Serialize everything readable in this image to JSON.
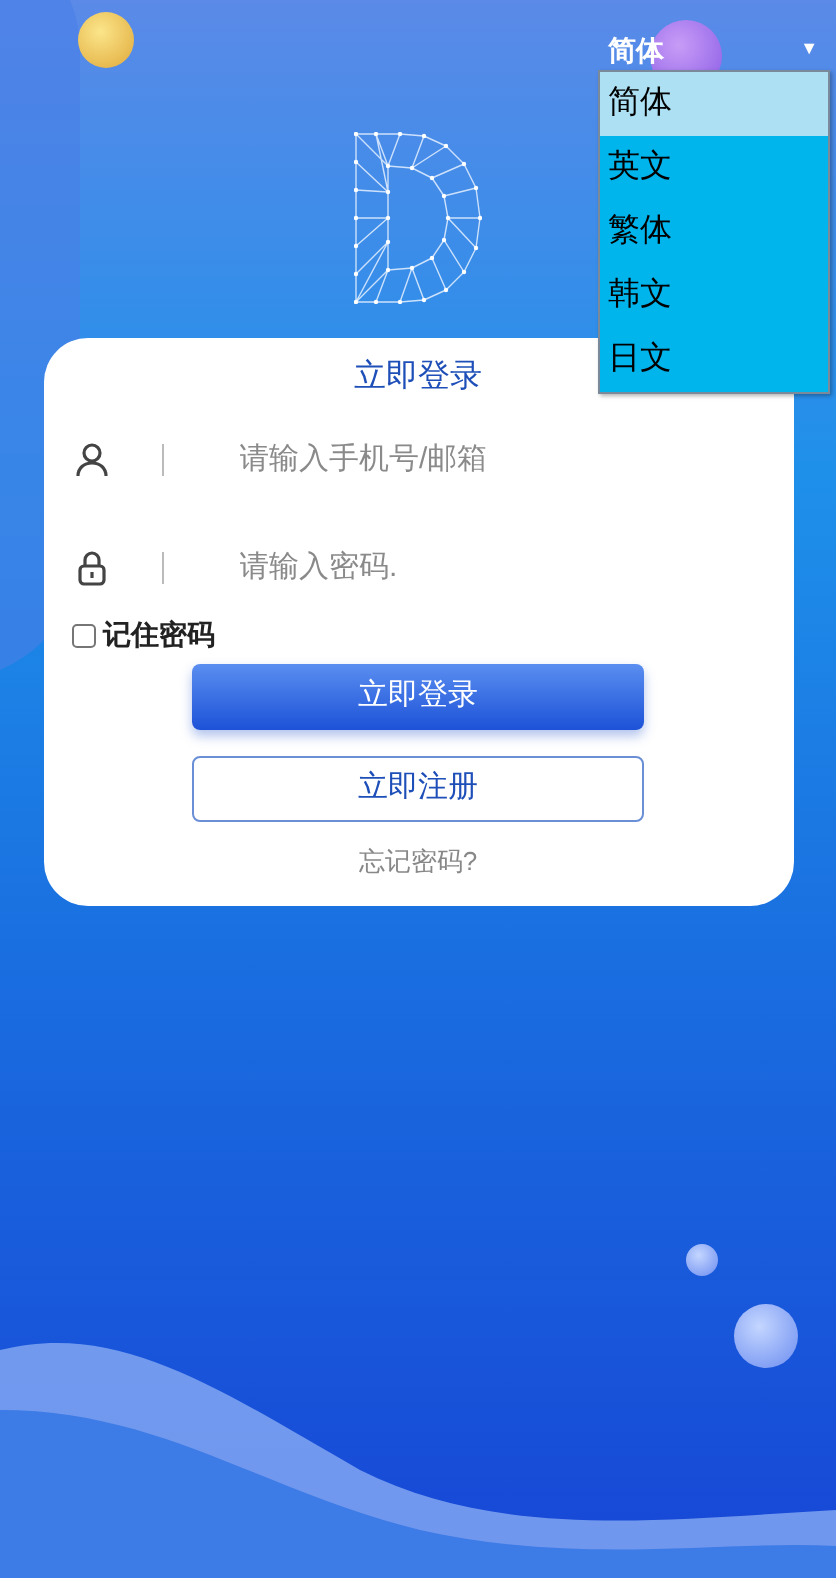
{
  "language_select": {
    "value": "简体",
    "caret": "▼",
    "expanded": true,
    "options": [
      {
        "label": "简体",
        "selected": true
      },
      {
        "label": "英文",
        "selected": false
      },
      {
        "label": "繁体",
        "selected": false
      },
      {
        "label": "韩文",
        "selected": false
      },
      {
        "label": "日文",
        "selected": false
      }
    ]
  },
  "login_card": {
    "title": "立即登录",
    "fields": [
      {
        "kind": "user",
        "placeholder": "请输入手机号/邮箱"
      },
      {
        "kind": "password",
        "placeholder": "请输入密码."
      }
    ],
    "remember": {
      "label": "记住密码",
      "checked": false
    },
    "login_button": "立即登录",
    "register_button": "立即注册",
    "forgot_link": "忘记密码?"
  }
}
